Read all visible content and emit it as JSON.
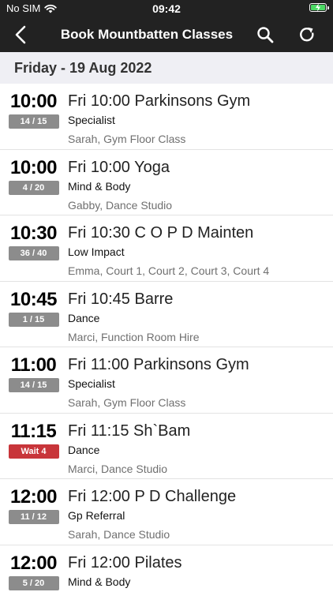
{
  "status_bar": {
    "carrier": "No SIM",
    "time": "09:42",
    "battery_color": "#4cd964"
  },
  "nav": {
    "title": "Book Mountbatten Classes",
    "back_icon": "chevron-left-icon",
    "search_icon": "search-icon",
    "refresh_icon": "refresh-icon"
  },
  "date_header": "Friday - 19 Aug 2022",
  "colors": {
    "header_bg": "#222222",
    "badge_grey": "#8c8c8c",
    "badge_wait": "#c8353a",
    "section_bg": "#efeff4"
  },
  "classes": [
    {
      "time": "10:00",
      "spaces": "14 / 15",
      "waitlist": false,
      "name": "Fri 10:00 Parkinsons Gym",
      "category": "Specialist",
      "details": "Sarah, Gym Floor Class"
    },
    {
      "time": "10:00",
      "spaces": "4 / 20",
      "waitlist": false,
      "name": "Fri 10:00 Yoga",
      "category": "Mind & Body",
      "details": "Gabby, Dance Studio"
    },
    {
      "time": "10:30",
      "spaces": "36 / 40",
      "waitlist": false,
      "name": "Fri 10:30 C O P D Mainten",
      "category": "Low Impact",
      "details": "Emma, Court 1, Court 2, Court 3, Court 4"
    },
    {
      "time": "10:45",
      "spaces": "1 / 15",
      "waitlist": false,
      "name": "Fri 10:45 Barre",
      "category": "Dance",
      "details": "Marci, Function Room Hire"
    },
    {
      "time": "11:00",
      "spaces": "14 / 15",
      "waitlist": false,
      "name": "Fri 11:00 Parkinsons Gym",
      "category": "Specialist",
      "details": "Sarah, Gym Floor Class"
    },
    {
      "time": "11:15",
      "spaces": "Wait 4",
      "waitlist": true,
      "name": "Fri 11:15 Sh`Bam",
      "category": "Dance",
      "details": "Marci, Dance Studio"
    },
    {
      "time": "12:00",
      "spaces": "11 / 12",
      "waitlist": false,
      "name": "Fri 12:00 P D Challenge",
      "category": "Gp Referral",
      "details": "Sarah, Dance Studio"
    },
    {
      "time": "12:00",
      "spaces": "5 / 20",
      "waitlist": false,
      "name": "Fri 12:00 Pilates",
      "category": "Mind & Body",
      "details": ""
    }
  ]
}
